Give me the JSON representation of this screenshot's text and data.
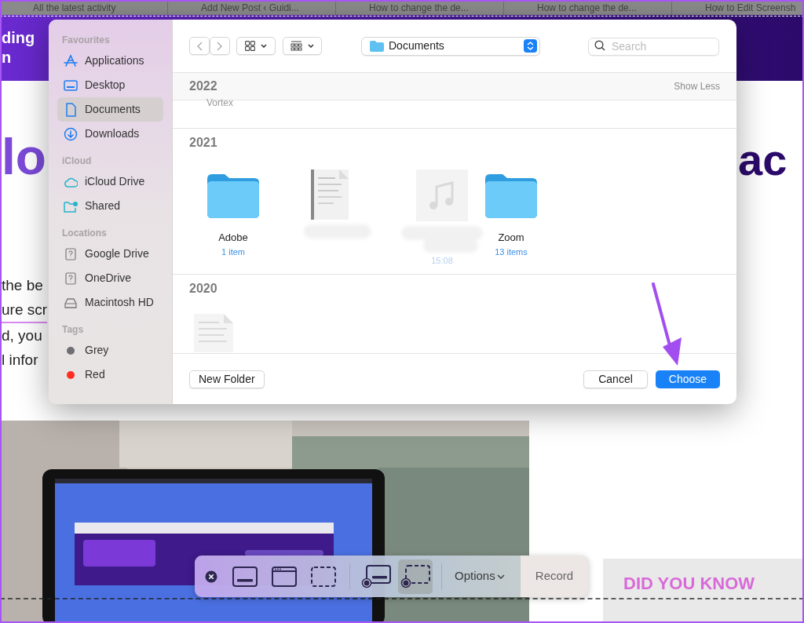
{
  "browser_tabs": [
    {
      "label": "All the latest activity"
    },
    {
      "label": "Add New Post ‹ Guidi..."
    },
    {
      "label": "How to change the de..."
    },
    {
      "label": "How to change the de..."
    },
    {
      "label": "How to Edit Screensh"
    }
  ],
  "page": {
    "header_lines": [
      "ding",
      "n"
    ],
    "heading_left": "lo",
    "heading_right": "ac",
    "body_lines": [
      "the be",
      "ure scr",
      "d, you",
      "l infor"
    ],
    "promo": "DID YOU KNOW"
  },
  "dialog": {
    "sidebar": [
      {
        "heading": "Favourites",
        "items": [
          {
            "label": "Applications",
            "selected": false
          },
          {
            "label": "Desktop",
            "selected": false
          },
          {
            "label": "Documents",
            "selected": true
          },
          {
            "label": "Downloads",
            "selected": false
          }
        ]
      },
      {
        "heading": "iCloud",
        "items": [
          {
            "label": "iCloud Drive",
            "selected": false
          },
          {
            "label": "Shared",
            "selected": false
          }
        ]
      },
      {
        "heading": "Locations",
        "items": [
          {
            "label": "Google Drive",
            "selected": false
          },
          {
            "label": "OneDrive",
            "selected": false
          },
          {
            "label": "Macintosh HD",
            "selected": false
          }
        ]
      },
      {
        "heading": "Tags",
        "items": [
          {
            "label": "Grey",
            "color": "#6e6e73",
            "selected": false
          },
          {
            "label": "Red",
            "color": "#ff2d20",
            "selected": false
          }
        ]
      }
    ],
    "location": "Documents",
    "search_placeholder": "Search",
    "sections": [
      {
        "year": "2022",
        "action": "Show Less",
        "items": [
          {
            "kind": "caption",
            "name": "Vortex"
          }
        ]
      },
      {
        "year": "2021",
        "items": [
          {
            "kind": "folder",
            "name": "Adobe",
            "detail": "1 item"
          },
          {
            "kind": "document"
          },
          {
            "kind": "audio",
            "detail": "15:08"
          },
          {
            "kind": "folder",
            "name": "Zoom",
            "detail": "13 items"
          }
        ]
      },
      {
        "year": "2020",
        "items": [
          {
            "kind": "document"
          }
        ]
      }
    ],
    "new_folder": "New Folder",
    "cancel": "Cancel",
    "choose": "Choose"
  },
  "capture_bar": {
    "tools": [
      {
        "kind": "close"
      },
      {
        "kind": "screen",
        "selected": false
      },
      {
        "kind": "window",
        "selected": false
      },
      {
        "kind": "selection",
        "selected": false
      },
      {
        "kind": "record-screen",
        "selected": false
      },
      {
        "kind": "record-selection",
        "selected": true
      }
    ],
    "options": "Options",
    "record": "Record"
  }
}
